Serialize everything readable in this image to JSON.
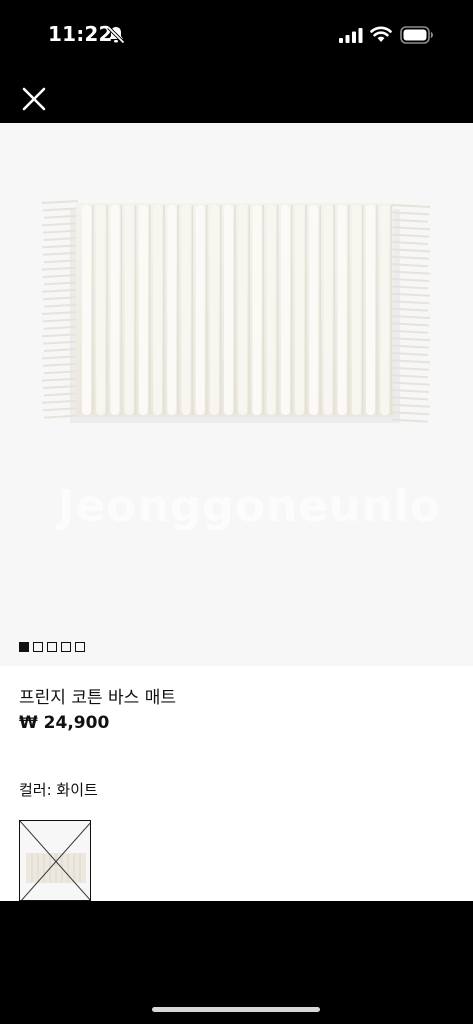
{
  "status_bar": {
    "time": "11:22",
    "icons": [
      "bell-slash-icon",
      "signal-icon",
      "wifi-icon",
      "battery-icon"
    ]
  },
  "nav": {
    "close_icon": "close-icon"
  },
  "product": {
    "name": "프린지 코튼 바스 매트",
    "price": "₩ 24,900",
    "color_label": "컬러: 화이트",
    "watermark": "Jeonggoneunlo"
  },
  "carousel": {
    "total": 5,
    "active_index": 0
  },
  "colors": {
    "background": "#000000",
    "image_background": "#f7f7f7",
    "rug": "#f1eee7",
    "text": "#111111"
  }
}
